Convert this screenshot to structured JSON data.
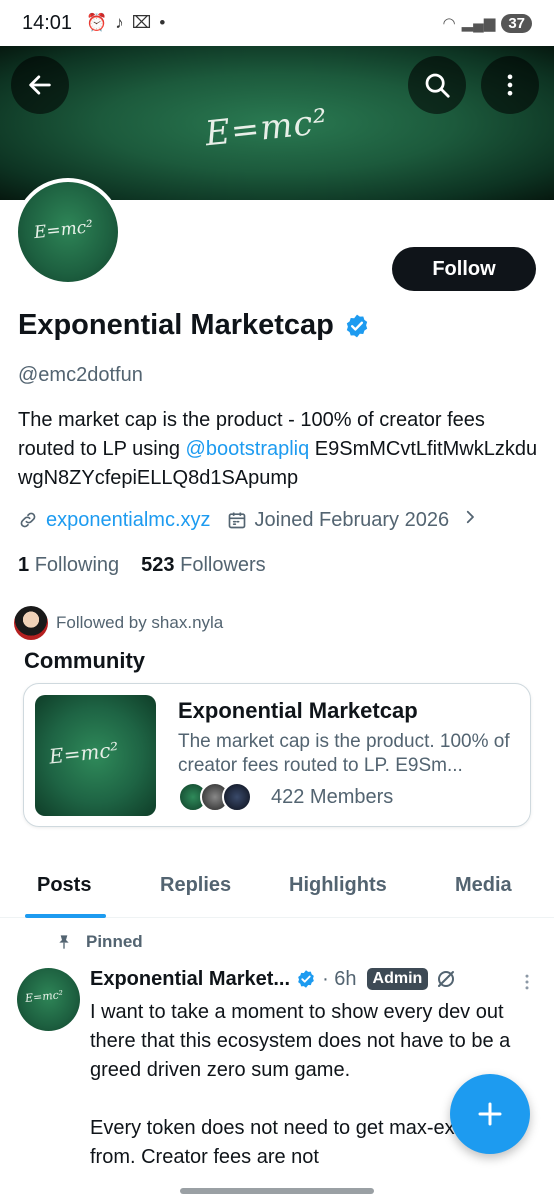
{
  "status_bar": {
    "time": "14:01",
    "notifications": [
      "alarm-icon",
      "tiktok-icon",
      "capcut-icon",
      "•"
    ],
    "battery": "37"
  },
  "banner": {
    "formula_text": "E=mc²"
  },
  "profile": {
    "avatar_formula": "E=mc²",
    "follow_label": "Follow",
    "display_name": "Exponential Marketcap",
    "handle": "@emc2dotfun",
    "bio_part1": "The market cap is the product - 100% of creator fees routed to LP using ",
    "bio_mention": "@bootstrapliq",
    "bio_part2": " E9SmMCvtLfitMwkLzkduwgN8ZYcfepiELLQ8d1SApump",
    "website": "exponentialmc.xyz",
    "joined": "Joined February 2026",
    "following_count": "1",
    "following_label": "Following",
    "followers_count": "523",
    "followers_label": "Followers",
    "followed_by": "Followed by shax.nyla"
  },
  "community": {
    "section_title": "Community",
    "image_formula": "E=mc²",
    "name": "Exponential Marketcap",
    "description": "The market cap is the product. 100% of creator fees routed to LP. E9Sm...",
    "members": "422 Members"
  },
  "tabs": [
    {
      "label": "Posts",
      "active": true
    },
    {
      "label": "Replies",
      "active": false
    },
    {
      "label": "Highlights",
      "active": false
    },
    {
      "label": "Media",
      "active": false
    }
  ],
  "post": {
    "pinned_label": "Pinned",
    "avatar_formula": "E=mc²",
    "author": "Exponential Market...",
    "time": "· 6h",
    "badge": "Admin",
    "text": "I want to take a moment to show every dev out there that this ecosystem does not have to be a greed driven zero sum game.\n\nEvery token does not need to get max-extracted from. Creator fees are not"
  },
  "colors": {
    "accent": "#1d9bf0",
    "banner_green": "#1c5a3c",
    "text_primary": "#0f1419",
    "text_secondary": "#536471"
  }
}
